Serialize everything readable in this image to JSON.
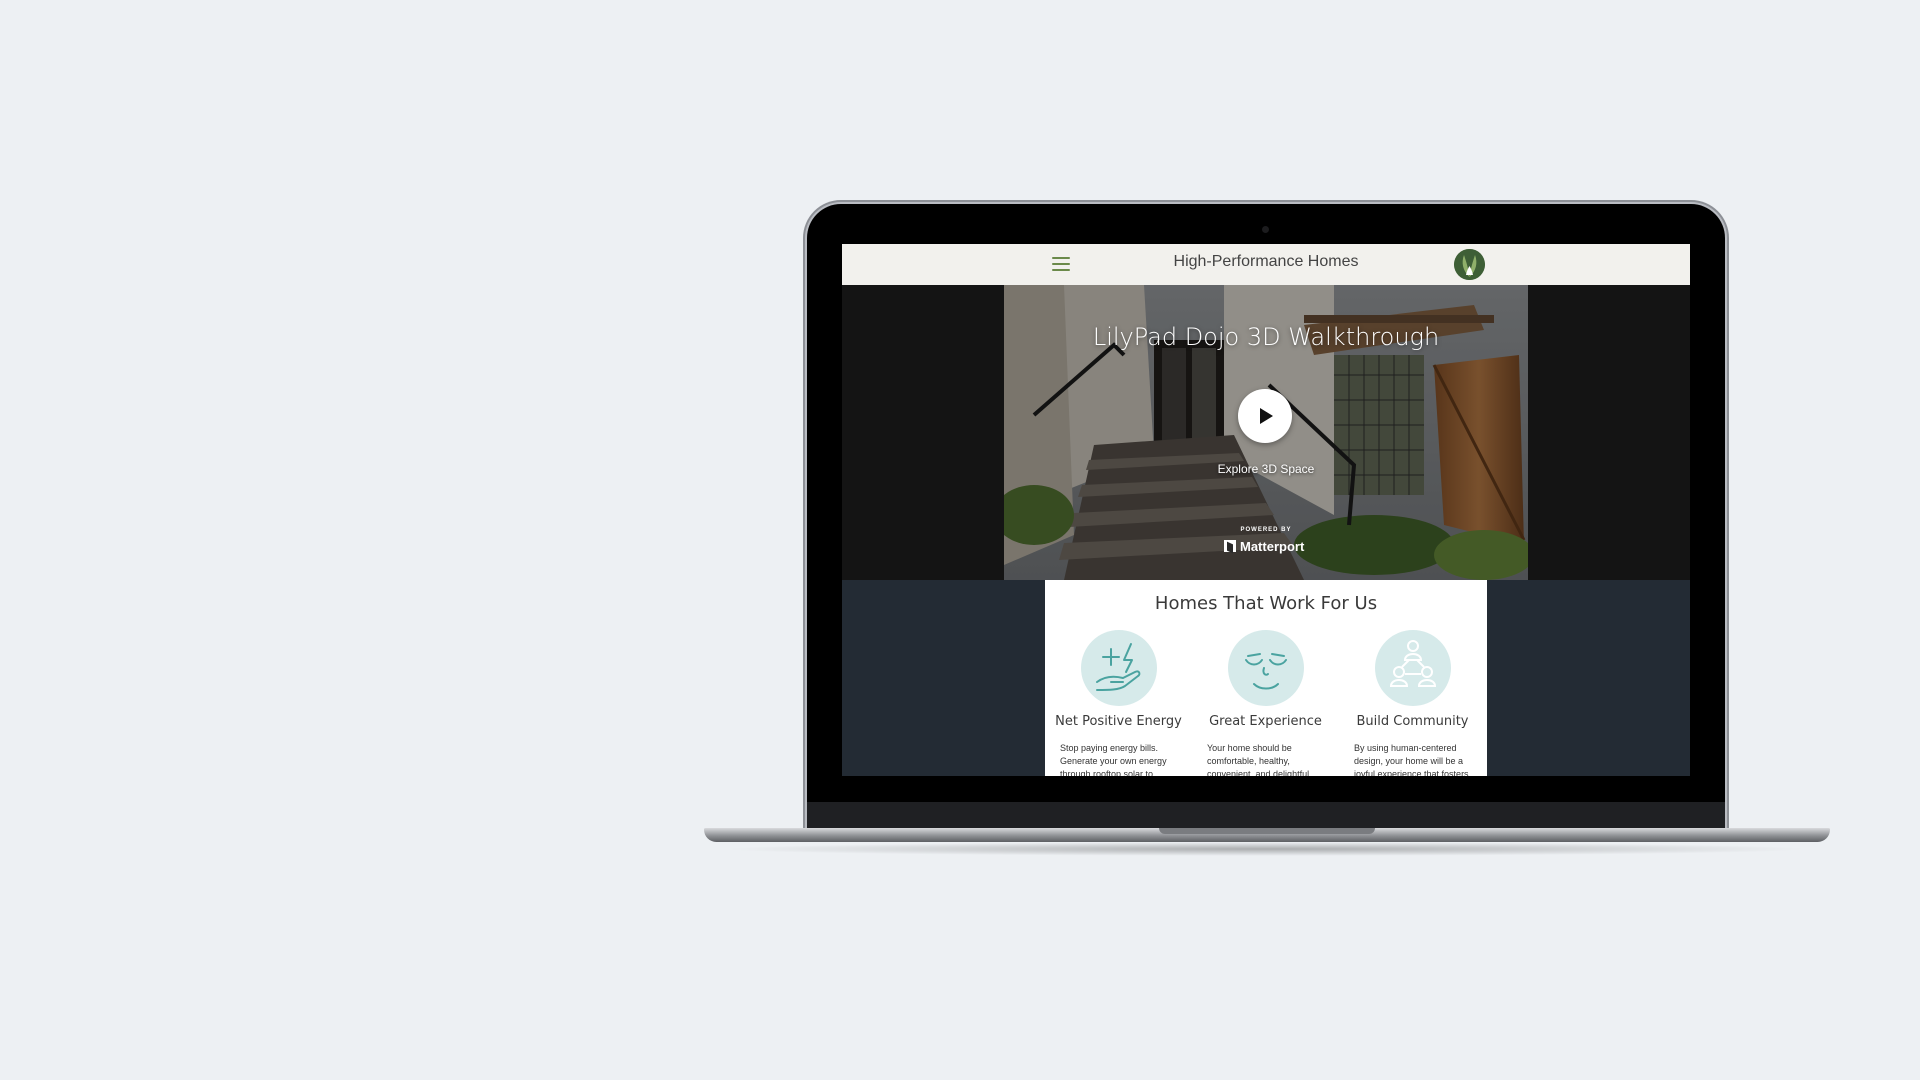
{
  "site": {
    "title": "High-Performance Homes",
    "menu_icon": "hamburger-menu-icon",
    "logo_icon": "lotus-logo-icon"
  },
  "video": {
    "title": "LilyPad Dojo 3D Walkthrough",
    "cta_label": "Explore 3D Space",
    "powered_by": "POWERED BY",
    "brand": "Matterport",
    "play_icon": "play-icon"
  },
  "features": {
    "heading": "Homes That Work For Us",
    "items": [
      {
        "title": "Net Positive Energy",
        "text": "Stop paying energy bills. Generate your own energy through rooftop solar to",
        "icon": "hand-energy-icon"
      },
      {
        "title": "Great Experience",
        "text": "Your home should be comfortable, healthy, convenient, and delightful.",
        "icon": "smiling-face-icon"
      },
      {
        "title": "Build Community",
        "text": "By using human-centered design, your home will be a joyful experience that fosters",
        "icon": "people-network-icon"
      }
    ]
  },
  "colors": {
    "page_background": "#edf0f3",
    "header_background": "#f2f1ed",
    "accent_green": "#6b8a4a",
    "features_band": "#232b34",
    "icon_circle": "#d6eaea",
    "icon_stroke": "#4aa3a0"
  }
}
